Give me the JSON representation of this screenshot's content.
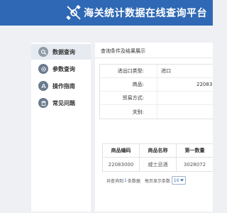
{
  "header": {
    "title": "海关统计数据在线查询平台",
    "logo_icon": "satellite-wrench-icon",
    "color": "#2f68b4"
  },
  "sidebar": {
    "items": [
      {
        "label": "数据查询",
        "icon": "search-data-icon",
        "active": true
      },
      {
        "label": "参数查询",
        "icon": "gear-icon",
        "active": false
      },
      {
        "label": "操作指南",
        "icon": "guide-icon",
        "active": false
      },
      {
        "label": "常见问题",
        "icon": "trash-icon",
        "active": false
      }
    ]
  },
  "main": {
    "title": "查询条件及结果展示",
    "conditions": [
      {
        "label": "进出口类型:",
        "value": "进口"
      },
      {
        "label": "商品:",
        "value": "22083"
      },
      {
        "label": "贸易方式:",
        "value": ""
      },
      {
        "label": "关别:",
        "value": ""
      }
    ],
    "results": {
      "columns": [
        "商品编码",
        "商品名称",
        "第一数量"
      ],
      "rows": [
        [
          "22083000",
          "威士忌酒",
          "3028072"
        ]
      ]
    },
    "pager": {
      "total_prefix": "共查询到",
      "total_count": "1",
      "total_suffix": "条数据",
      "page_size_label": "每页显示条数",
      "page_size": "10"
    }
  }
}
